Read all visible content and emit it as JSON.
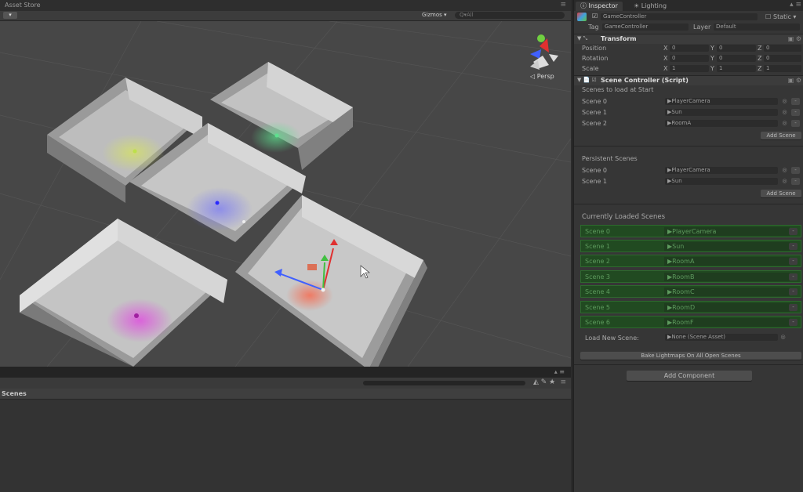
{
  "scene_panel": {
    "tab_title": "Asset Store",
    "gizmos_label": "Gizmos ▾",
    "search_placeholder": "Q▾All",
    "persp_label": "◁ Persp",
    "camera_button": "▾"
  },
  "scenes_panel": {
    "title": "Scenes"
  },
  "inspector": {
    "tabs": [
      {
        "label": "Inspector",
        "active": true
      },
      {
        "label": "Lighting",
        "active": false
      }
    ],
    "object_name": "GameController",
    "static_label": "Static ▾",
    "tag_label": "Tag",
    "tag_value": "GameController",
    "layer_label": "Layer",
    "layer_value": "Default",
    "transform": {
      "title": "Transform",
      "rows": [
        {
          "label": "Position",
          "x": "0",
          "y": "0",
          "z": "0"
        },
        {
          "label": "Rotation",
          "x": "0",
          "y": "0",
          "z": "0"
        },
        {
          "label": "Scale",
          "x": "1",
          "y": "1",
          "z": "1"
        }
      ],
      "axis_labels": [
        "X",
        "Y",
        "Z"
      ]
    },
    "scene_controller": {
      "title": "Scene Controller (Script)",
      "load_at_start_label": "Scenes to load at Start",
      "load_at_start": [
        {
          "label": "Scene 0",
          "value": "PlayerCamera"
        },
        {
          "label": "Scene 1",
          "value": "Sun"
        },
        {
          "label": "Scene 2",
          "value": "RoomA"
        }
      ],
      "add_scene_label": "Add Scene",
      "persistent_label": "Persistent Scenes",
      "persistent": [
        {
          "label": "Scene 0",
          "value": "PlayerCamera"
        },
        {
          "label": "Scene 1",
          "value": "Sun"
        }
      ],
      "add_scene_label_2": "Add Scene",
      "loaded_label": "Currently Loaded Scenes",
      "loaded": [
        {
          "label": "Scene 0",
          "value": "PlayerCamera"
        },
        {
          "label": "Scene 1",
          "value": "Sun"
        },
        {
          "label": "Scene 2",
          "value": "RoomA"
        },
        {
          "label": "Scene 3",
          "value": "RoomB"
        },
        {
          "label": "Scene 4",
          "value": "RoomC"
        },
        {
          "label": "Scene 5",
          "value": "RoomD"
        },
        {
          "label": "Scene 6",
          "value": "RoomF"
        }
      ],
      "load_new_label": "Load New Scene:",
      "load_new_value": "None (Scene Asset)",
      "bake_label": "Bake Lightmaps On All Open Scenes"
    },
    "add_component_label": "Add Component"
  },
  "colors": {
    "loaded_row_bg": "#214a21",
    "light_yellow": "#d8e65a",
    "light_green": "#5ee08e",
    "light_blue": "#3a3aff",
    "light_magenta": "#e04ae0",
    "light_red": "#ff3a2a"
  }
}
